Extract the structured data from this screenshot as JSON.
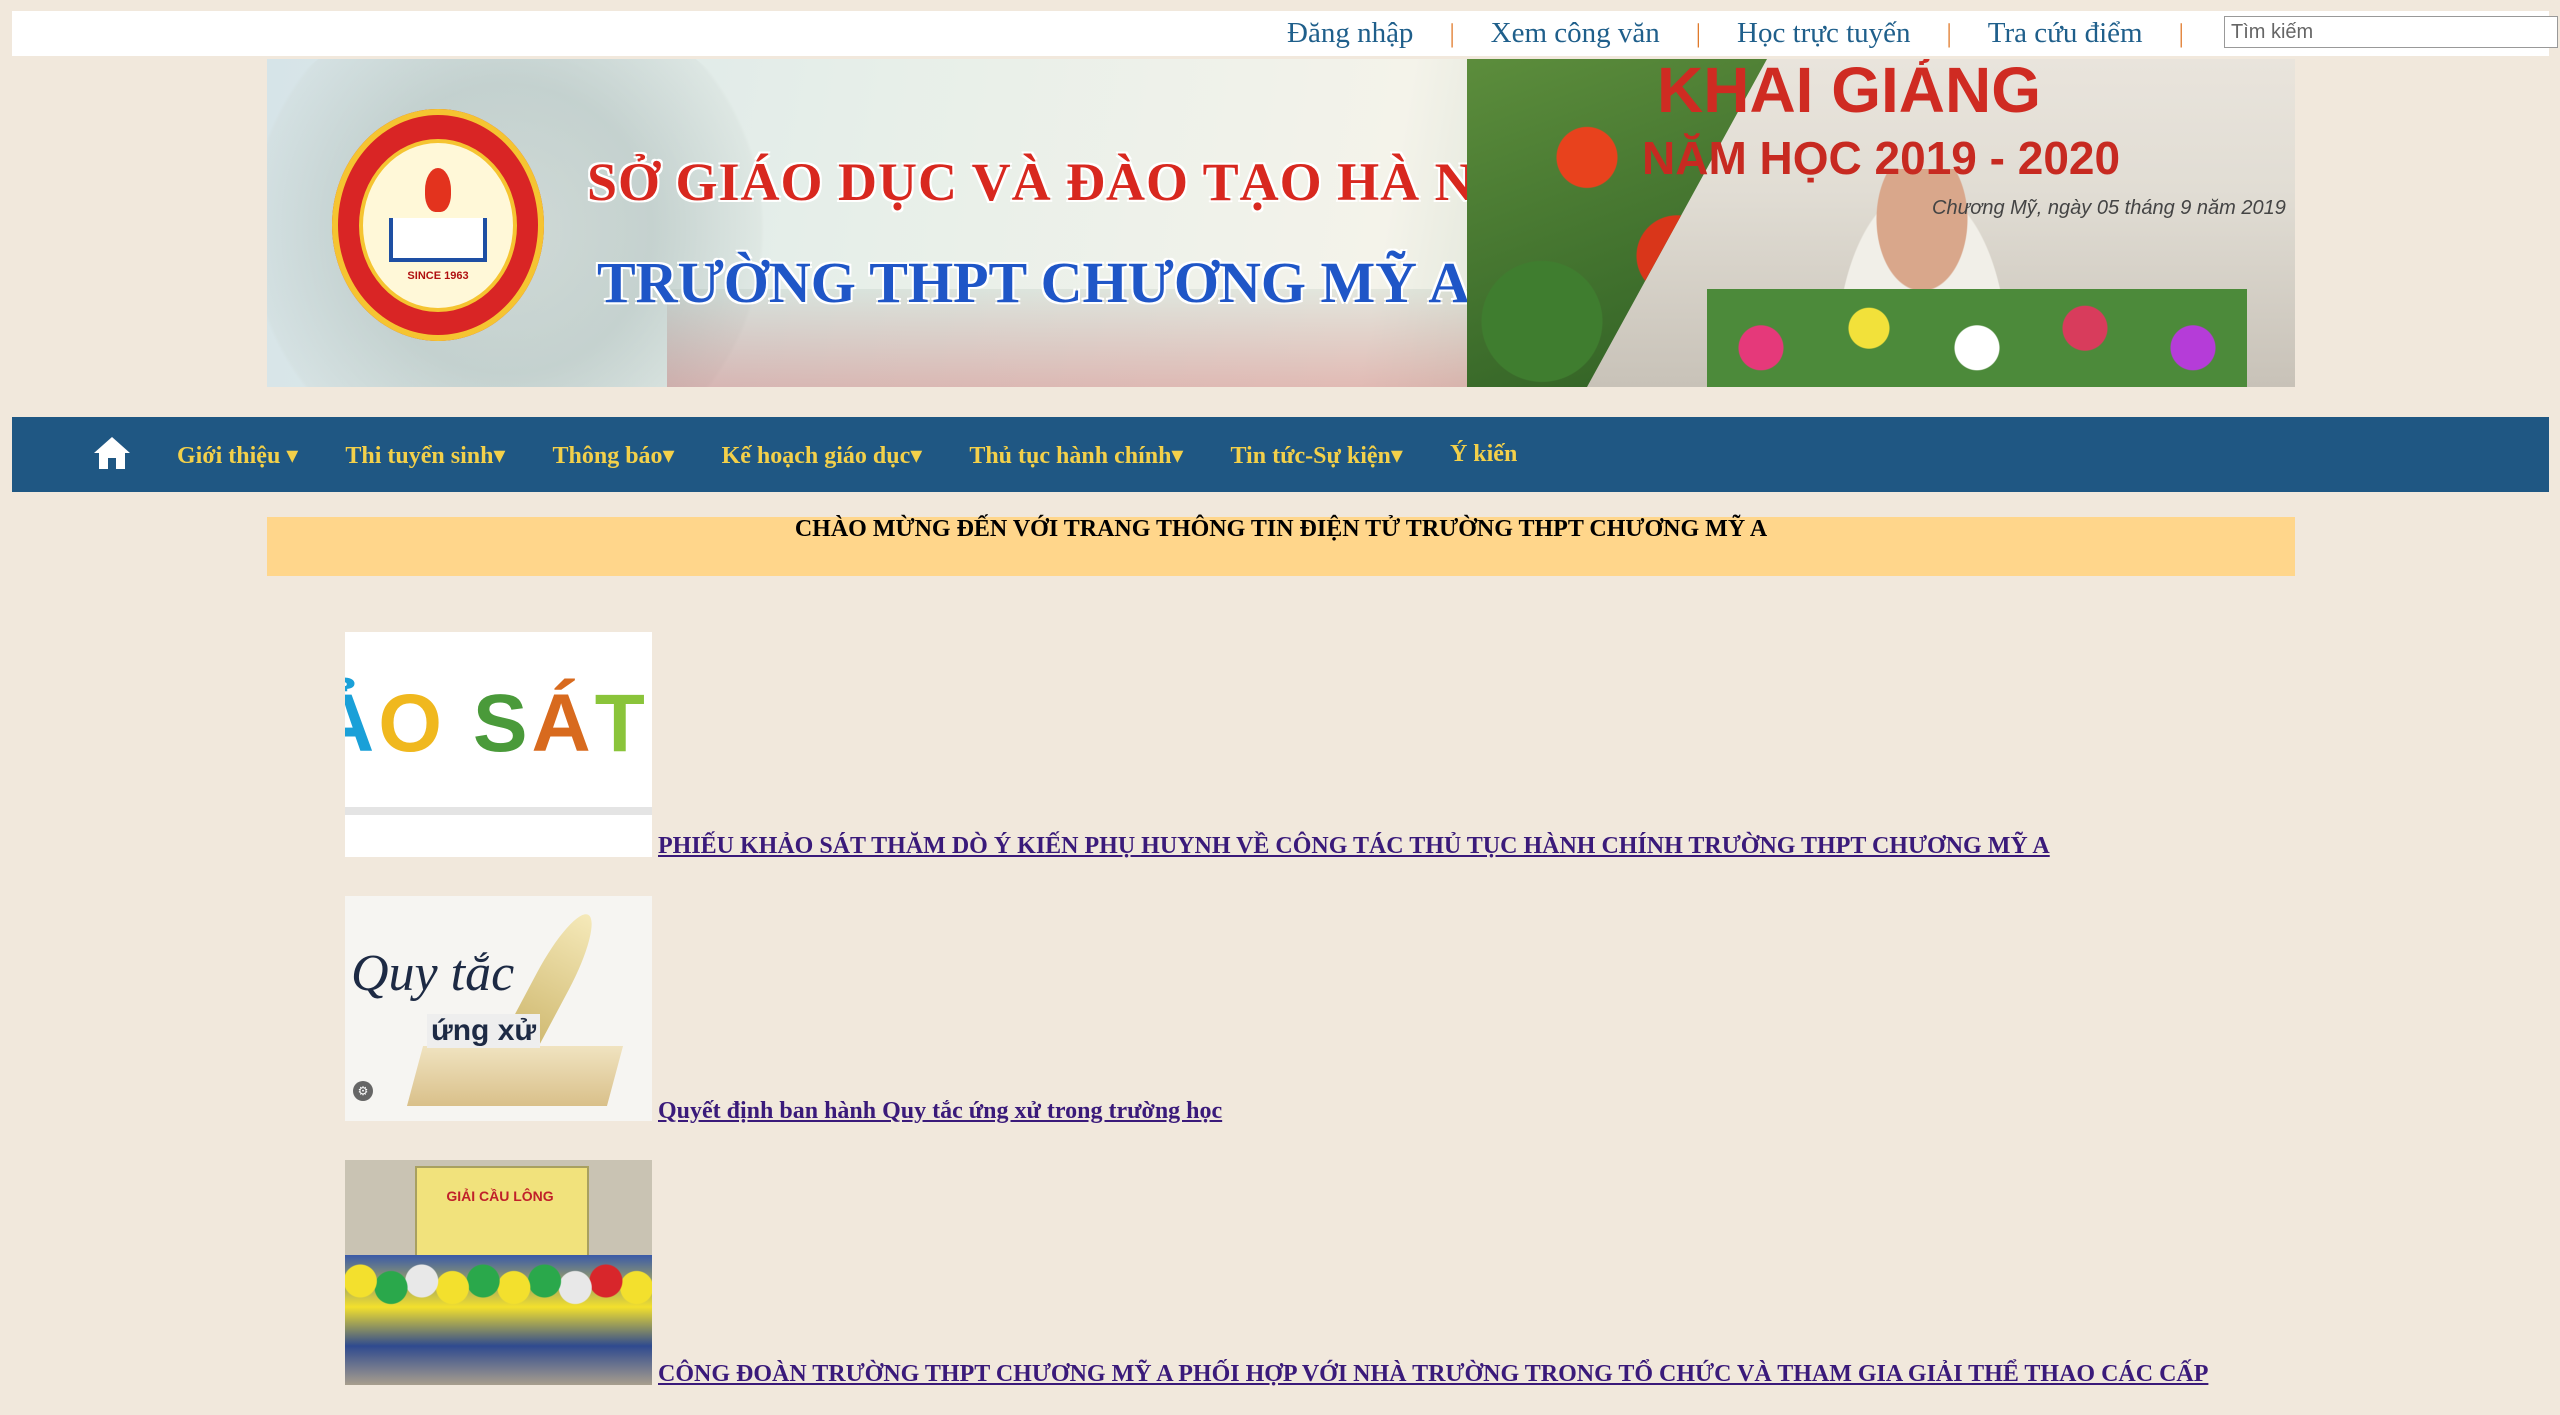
{
  "topbar": {
    "links": [
      "Đăng nhập",
      "Xem công văn",
      "Học trực tuyến",
      "Tra cứu điểm"
    ],
    "separator": "|",
    "search_placeholder": "Tìm kiếm"
  },
  "banner": {
    "line1": "SỞ GIÁO DỤC VÀ ĐÀO TẠO HÀ NỘI",
    "line2": "TRƯỜNG THPT CHƯƠNG MỸ A",
    "event_title": "KHAI GIẢNG",
    "event_year": "NĂM HỌC 2019 - 2020",
    "event_date": "Chương Mỹ, ngày 05 tháng 9 năm 2019",
    "logo_since": "SINCE 1963"
  },
  "nav": {
    "home_icon": "home-icon",
    "items": [
      "Giới thiệu ▾",
      "Thi tuyển sinh▾",
      "Thông báo▾",
      "Kế hoạch giáo dục▾",
      "Thủ tục hành chính▾",
      "Tin tức-Sự kiện▾",
      "Ý kiến"
    ]
  },
  "welcome": "CHÀO MỪNG ĐẾN VỚI TRANG THÔNG TIN ĐIỆN TỬ TRƯỜNG THPT CHƯƠNG MỸ A",
  "news": [
    {
      "title": "PHIẾU KHẢO SÁT THĂM DÒ Ý KIẾN PHỤ HUYNH VỀ CÔNG TÁC THỦ TỤC HÀNH CHÍNH TRƯỜNG THPT CHƯƠNG MỸ A",
      "thumb_text": "ẢO SÁT"
    },
    {
      "title": "Quyết định ban hành Quy tắc ứng xử trong trường học",
      "thumb_text_1": "Quy tắc",
      "thumb_text_2": "ứng xử"
    },
    {
      "title": "CÔNG ĐOÀN TRƯỜNG THPT CHƯƠNG MỸ A PHỐI HỢP VỚI NHÀ TRƯỜNG TRONG TỔ CHỨC VÀ THAM GIA GIẢI THỂ THAO CÁC CẤP",
      "thumb_text": "GIẢI CẦU LÔNG"
    }
  ],
  "colors": {
    "page_bg": "#f1e8dc",
    "nav_bg": "#1f5783",
    "nav_text": "#f3d04a",
    "welcome_bg": "#ffd68b",
    "link": "#3a1a7a",
    "toplink": "#1f5f8b"
  }
}
